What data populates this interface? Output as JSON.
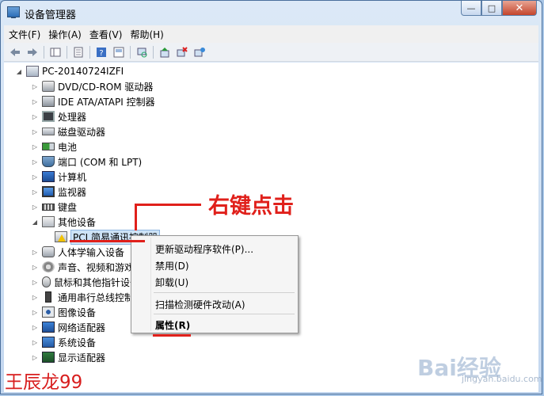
{
  "window": {
    "title": "设备管理器",
    "controls": {
      "minimize": "—",
      "maximize": "□",
      "close": "✕"
    }
  },
  "menubar": [
    "文件(F)",
    "操作(A)",
    "查看(V)",
    "帮助(H)"
  ],
  "toolbar": [
    "back-icon",
    "forward-icon",
    "console-tree-icon",
    "properties-icon",
    "help-icon",
    "view-icon",
    "scan-icon",
    "update-driver-icon",
    "uninstall-icon",
    "enable-icon"
  ],
  "tree": {
    "root": "PC-20140724IZFI",
    "items": [
      {
        "label": "DVD/CD-ROM 驱动器",
        "icon": "dvd-drive-icon"
      },
      {
        "label": "IDE ATA/ATAPI 控制器",
        "icon": "ide-controller-icon"
      },
      {
        "label": "处理器",
        "icon": "processor-icon"
      },
      {
        "label": "磁盘驱动器",
        "icon": "disk-drive-icon"
      },
      {
        "label": "电池",
        "icon": "battery-icon"
      },
      {
        "label": "端口 (COM 和 LPT)",
        "icon": "port-icon"
      },
      {
        "label": "计算机",
        "icon": "computer-icon"
      },
      {
        "label": "监视器",
        "icon": "monitor-icon"
      },
      {
        "label": "键盘",
        "icon": "keyboard-icon"
      },
      {
        "label": "其他设备",
        "icon": "other-devices-icon",
        "expanded": true
      },
      {
        "label": "PCI 简易通讯控制器",
        "icon": "warning-device-icon",
        "child": true,
        "selected": true
      },
      {
        "label": "人体学输入设备",
        "icon": "hid-icon"
      },
      {
        "label": "声音、视频和游戏控制器",
        "icon": "sound-icon"
      },
      {
        "label": "鼠标和其他指针设备",
        "icon": "mouse-icon"
      },
      {
        "label": "通用串行总线控制器",
        "icon": "usb-icon"
      },
      {
        "label": "图像设备",
        "icon": "imaging-icon"
      },
      {
        "label": "网络适配器",
        "icon": "network-icon"
      },
      {
        "label": "系统设备",
        "icon": "system-icon"
      },
      {
        "label": "显示适配器",
        "icon": "display-icon"
      }
    ]
  },
  "context_menu": {
    "items": [
      {
        "label": "更新驱动程序软件(P)..."
      },
      {
        "label": "禁用(D)"
      },
      {
        "label": "卸载(U)"
      },
      {
        "label": "扫描检测硬件改动(A)"
      },
      {
        "label": "属性(R)",
        "bold": true
      }
    ]
  },
  "annotation": {
    "text": "右键点击",
    "color": "#e0201b"
  },
  "watermark": {
    "signature": "王辰龙99",
    "logo": "Bai经验",
    "sub": "jingyan.baidu.com"
  }
}
